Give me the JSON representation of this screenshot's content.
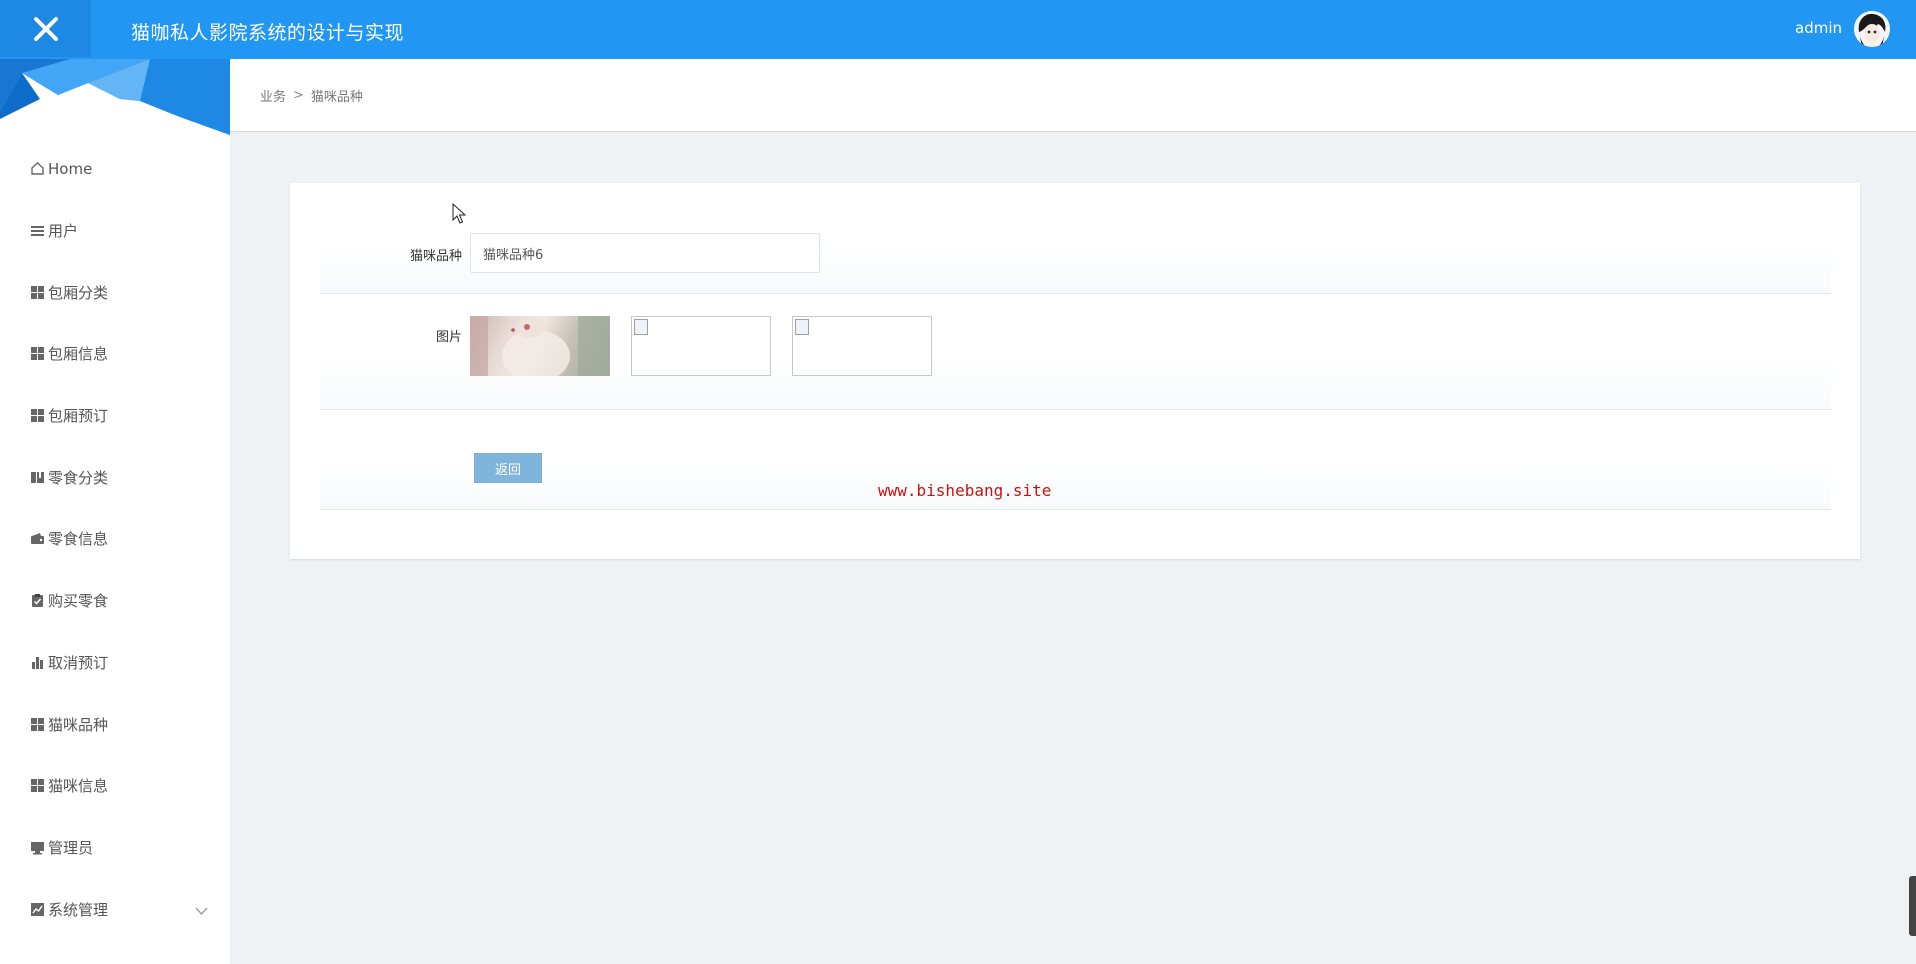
{
  "header": {
    "app_title": "猫咖私人影院系统的设计与实现",
    "user_name": "admin",
    "close_icon": "close-icon"
  },
  "sidebar": {
    "items": [
      {
        "label": "Home",
        "icon": "home-icon"
      },
      {
        "label": "用户",
        "icon": "list-icon"
      },
      {
        "label": "包厢分类",
        "icon": "grid-icon"
      },
      {
        "label": "包厢信息",
        "icon": "grid-icon"
      },
      {
        "label": "包厢预订",
        "icon": "grid-icon"
      },
      {
        "label": "零食分类",
        "icon": "book-icon"
      },
      {
        "label": "零食信息",
        "icon": "wallet-icon"
      },
      {
        "label": "购买零食",
        "icon": "clipboard-icon"
      },
      {
        "label": "取消预订",
        "icon": "bar-chart-icon"
      },
      {
        "label": "猫咪品种",
        "icon": "grid-icon"
      },
      {
        "label": "猫咪信息",
        "icon": "grid-icon"
      },
      {
        "label": "管理员",
        "icon": "monitor-icon"
      },
      {
        "label": "系统管理",
        "icon": "line-chart-icon",
        "has_submenu": true
      }
    ]
  },
  "breadcrumb": {
    "parent": "业务",
    "separator": ">",
    "current": "猫咪品种"
  },
  "form": {
    "breed_label": "猫咪品种",
    "breed_value": "猫咪品种6",
    "image_label": "图片",
    "back_button": "返回"
  },
  "watermark": "www.bishebang.site",
  "colors": {
    "topbar": "#2196f3",
    "button": "#7fb5db",
    "background": "#eff2f4",
    "watermark": "#cc1111"
  }
}
